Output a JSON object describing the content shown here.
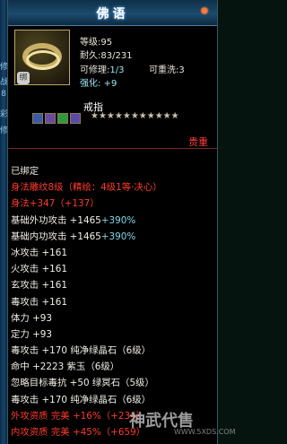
{
  "edge_chars": [
    "修",
    "战",
    "8",
    "彩",
    "修"
  ],
  "title": "佛语",
  "item": {
    "level": "等级:95",
    "durability": "耐久:83/231",
    "repairable_label": "可修理:",
    "repairable_value": "1/3",
    "reforge": "可重洗:3",
    "enhance_label": "强化:",
    "enhance_value": "+9",
    "name": "戒指",
    "stars": "★★★★★★★★★★★",
    "bag_badge": "绑",
    "valuable": "贵重"
  },
  "colors": {
    "red": "#ff3b2a",
    "cyan": "#9be3f2"
  },
  "lines": [
    {
      "text": "已绑定",
      "style": "white"
    },
    {
      "text": "身法雕纹8级（精绘：4级1等·决心）",
      "style": "red"
    },
    {
      "text": "身法+347（+137）",
      "style": "red"
    },
    {
      "text": "基础外功攻击 +1465",
      "extra": "+390%",
      "style": "white"
    },
    {
      "text": "基础内功攻击 +1465",
      "extra": "+390%",
      "style": "white"
    },
    {
      "text": "冰攻击 +161",
      "style": "white"
    },
    {
      "text": "火攻击 +161",
      "style": "white"
    },
    {
      "text": "玄攻击 +161",
      "style": "white"
    },
    {
      "text": "毒攻击 +161",
      "style": "white"
    },
    {
      "text": "体力 +93",
      "style": "white"
    },
    {
      "text": "定力 +93",
      "style": "white"
    },
    {
      "text": "毒攻击 +170 纯净绿晶石（6级）",
      "style": "white"
    },
    {
      "text": "命中 +2223 紫玉（6级）",
      "style": "white"
    },
    {
      "text": "忽略目标毒抗 +50 绿冥石（5级）",
      "style": "white"
    },
    {
      "text": "毒攻击 +170 纯净绿晶石（6级）",
      "style": "white"
    },
    {
      "text": "外攻资质  完美 +16%（+234）",
      "style": "red"
    },
    {
      "text": "内攻资质  完美 +45%（+659）",
      "style": "red"
    }
  ],
  "watermark": "神武代售",
  "watermark_url": "WWW.5XDS.COM"
}
